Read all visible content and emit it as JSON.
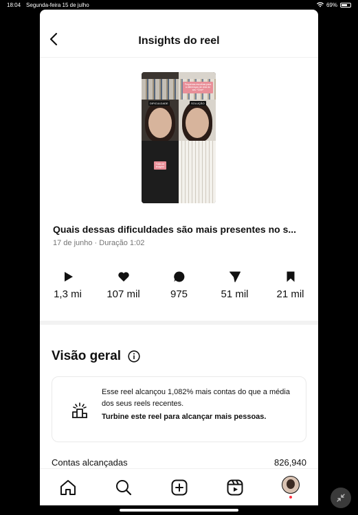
{
  "statusbar": {
    "time": "18:04",
    "date": "Segunda-feira 15 de julho",
    "battery": "69%",
    "battery_level": 0.69
  },
  "header": {
    "title": "Insights do reel"
  },
  "thumbnail": {
    "caption": "Pequenas escolhas para a diferenças de vida do seu *Cine*",
    "left_label": "DIFICULDADE",
    "right_label": "SOLUÇÃO",
    "pink_label": "Falta de imagem"
  },
  "reel": {
    "title": "Quais dessas dificuldades são mais presentes no s...",
    "meta": "17 de junho · Duração 1:02"
  },
  "metrics": [
    {
      "icon": "play-icon",
      "value": "1,3 mi"
    },
    {
      "icon": "heart-icon",
      "value": "107 mil"
    },
    {
      "icon": "comment-icon",
      "value": "975"
    },
    {
      "icon": "share-icon",
      "value": "51 mil"
    },
    {
      "icon": "bookmark-icon",
      "value": "21 mil"
    }
  ],
  "overview": {
    "heading": "Visão geral",
    "card_text": "Esse reel alcançou 1,082% mais contas do que a média dos seus reels recentes.",
    "card_cta": "Turbine este reel para alcançar mais pessoas."
  },
  "stats": {
    "reached_label": "Contas alcançadas",
    "reached_value": "826,940"
  },
  "tabbar": [
    "home-icon",
    "search-icon",
    "create-icon",
    "reels-icon",
    "profile-avatar"
  ]
}
